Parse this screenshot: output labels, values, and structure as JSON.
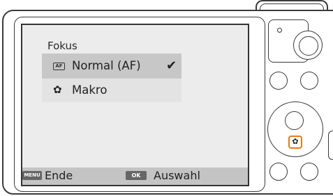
{
  "menu": {
    "title": "Fokus",
    "items": [
      {
        "icon_text": "AF",
        "label": "Normal (AF)",
        "selected": true,
        "check": "✔"
      },
      {
        "icon_glyph": "✿",
        "label": "Makro",
        "selected": false
      }
    ]
  },
  "footer": {
    "menu_key": "MENU",
    "menu_action": "Ende",
    "ok_key": "OK",
    "ok_action": "Auswahl"
  },
  "controls": {
    "macro_key_glyph": "✿",
    "highlight_color": "#e87a13"
  }
}
